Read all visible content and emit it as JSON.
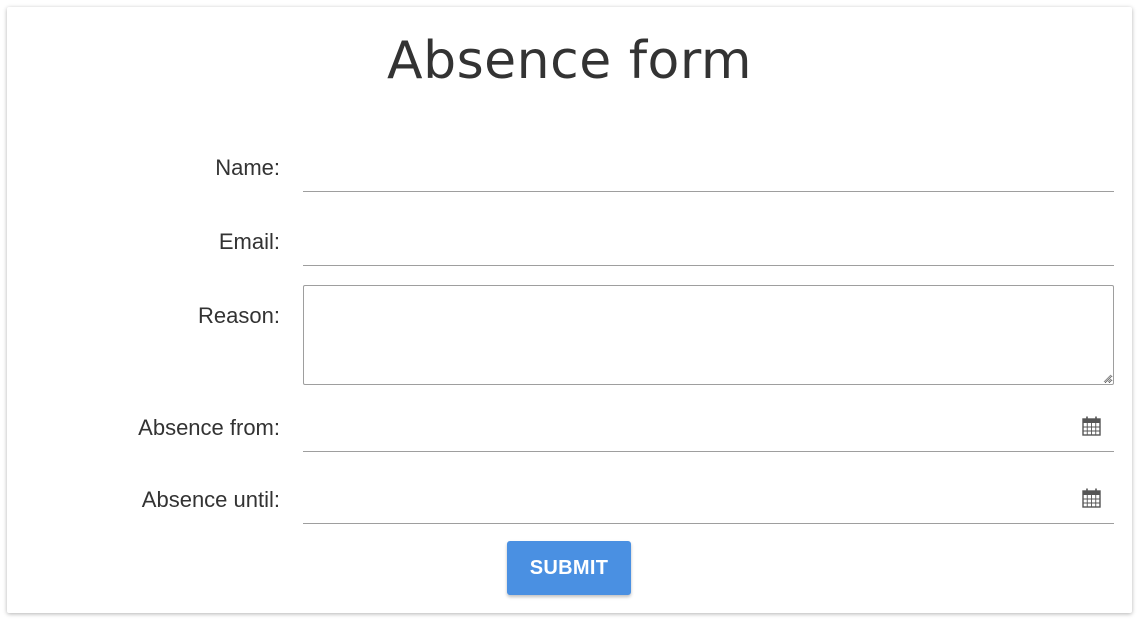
{
  "form": {
    "title": "Absence form",
    "fields": {
      "name": {
        "label": "Name:",
        "value": ""
      },
      "email": {
        "label": "Email:",
        "value": ""
      },
      "reason": {
        "label": "Reason:",
        "value": ""
      },
      "absence_from": {
        "label": "Absence from:",
        "value": "",
        "icon": "calendar-icon"
      },
      "absence_until": {
        "label": "Absence until:",
        "value": "",
        "icon": "calendar-icon"
      }
    },
    "submit_label": "SUBMIT"
  },
  "colors": {
    "accent": "#4a90e2",
    "text": "#333333",
    "underline": "#9e9e9e",
    "background": "#ffffff"
  }
}
